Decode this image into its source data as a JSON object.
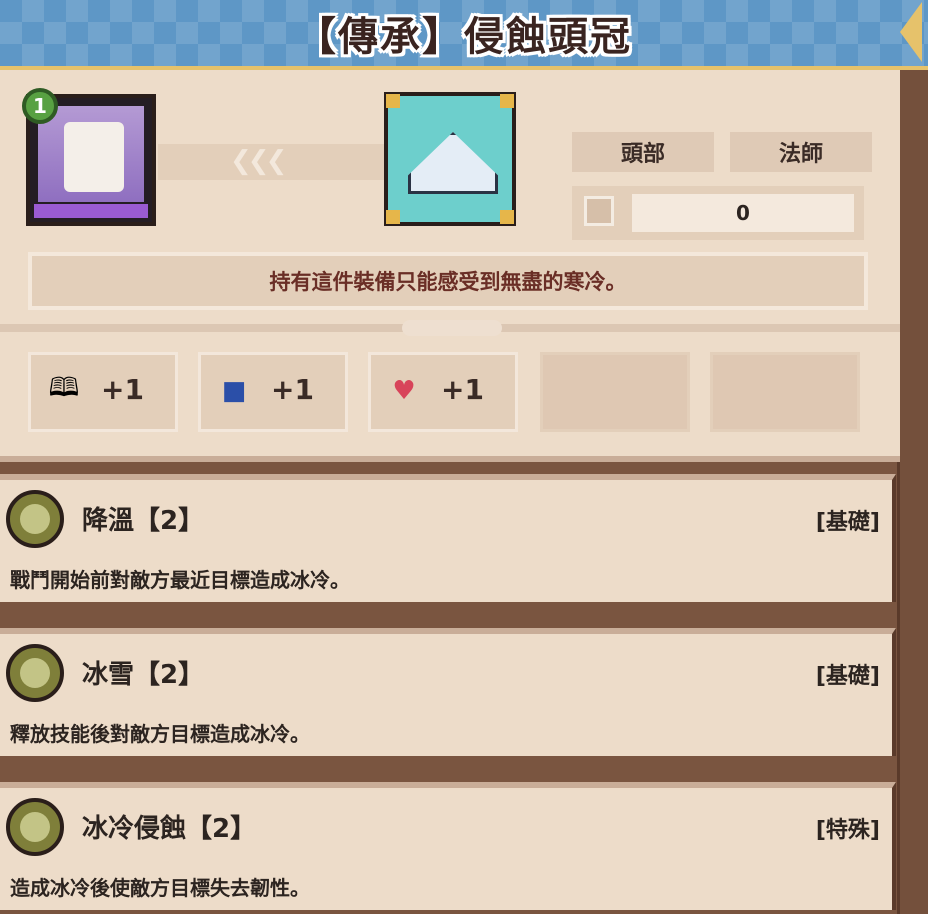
{
  "title": "【傳承】侵蝕頭冠",
  "character": {
    "level": "1"
  },
  "equipment": {
    "slot_label": "頭部",
    "class_label": "法師",
    "count": "0",
    "description": "持有這件裝備只能感受到無盡的寒冷。"
  },
  "stats": [
    {
      "icon": "book-icon",
      "value": "+1"
    },
    {
      "icon": "boot-icon",
      "value": "+1"
    },
    {
      "icon": "heart-icon",
      "value": "+1"
    }
  ],
  "skills": [
    {
      "name": "降溫【2】",
      "type": "[基礎]",
      "description": "戰鬥開始前對敵方最近目標造成冰冷。"
    },
    {
      "name": "冰雪【2】",
      "type": "[基礎]",
      "description": "釋放技能後對敵方目標造成冰冷。"
    },
    {
      "name": "冰冷侵蝕【2】",
      "type": "[特殊]",
      "description": "造成冰冷後使敵方目標失去韌性。"
    }
  ],
  "colors": {
    "banner": "#5e97c6",
    "panel": "#eddcc9",
    "description_text": "#6a2e26",
    "frame": "#7a5540"
  }
}
